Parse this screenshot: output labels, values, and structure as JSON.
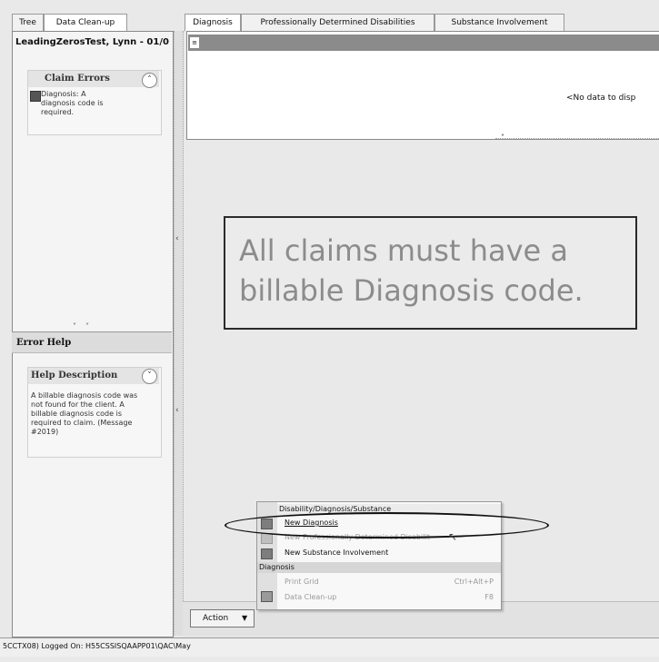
{
  "left_pane": {
    "tabs": [
      {
        "label": "Tree"
      },
      {
        "label": "Data Clean-up"
      }
    ],
    "client_name": "LeadingZerosTest, Lynn - 01/0",
    "claim_errors": {
      "title": "Claim Errors",
      "item_text": "Diagnosis: A diagnosis code is required."
    },
    "error_help": {
      "title": "Error Help",
      "help_title": "Help Description",
      "help_text": "A billable diagnosis code was not found for the client. A billable diagnosis code is required to claim. (Message #2019)"
    }
  },
  "right_pane": {
    "tabs": [
      {
        "label": "Diagnosis"
      },
      {
        "label": "Professionally Determined Disabilities"
      },
      {
        "label": "Substance Involvement"
      }
    ],
    "grid_empty_text": "<No data to disp",
    "callout_text": "All claims must have a billable Diagnosis code.",
    "action_button": "Action"
  },
  "context_menu": {
    "section1_header": "Disability/Diagnosis/Substance",
    "items1": [
      {
        "label": "New Diagnosis",
        "enabled": true
      },
      {
        "label": "New Professionally Determined Disabilit",
        "enabled": false
      },
      {
        "label": "New Substance Involvement",
        "enabled": true
      }
    ],
    "section2_header": "Diagnosis",
    "items2": [
      {
        "label": "Print Grid",
        "shortcut": "Ctrl+Alt+P",
        "enabled": false
      },
      {
        "label": "Data Clean-up",
        "shortcut": "F8",
        "enabled": false
      }
    ]
  },
  "status_bar": {
    "text": "5CCTX08) Logged On: H55CSSISQAAPP01\\QAC\\May"
  }
}
